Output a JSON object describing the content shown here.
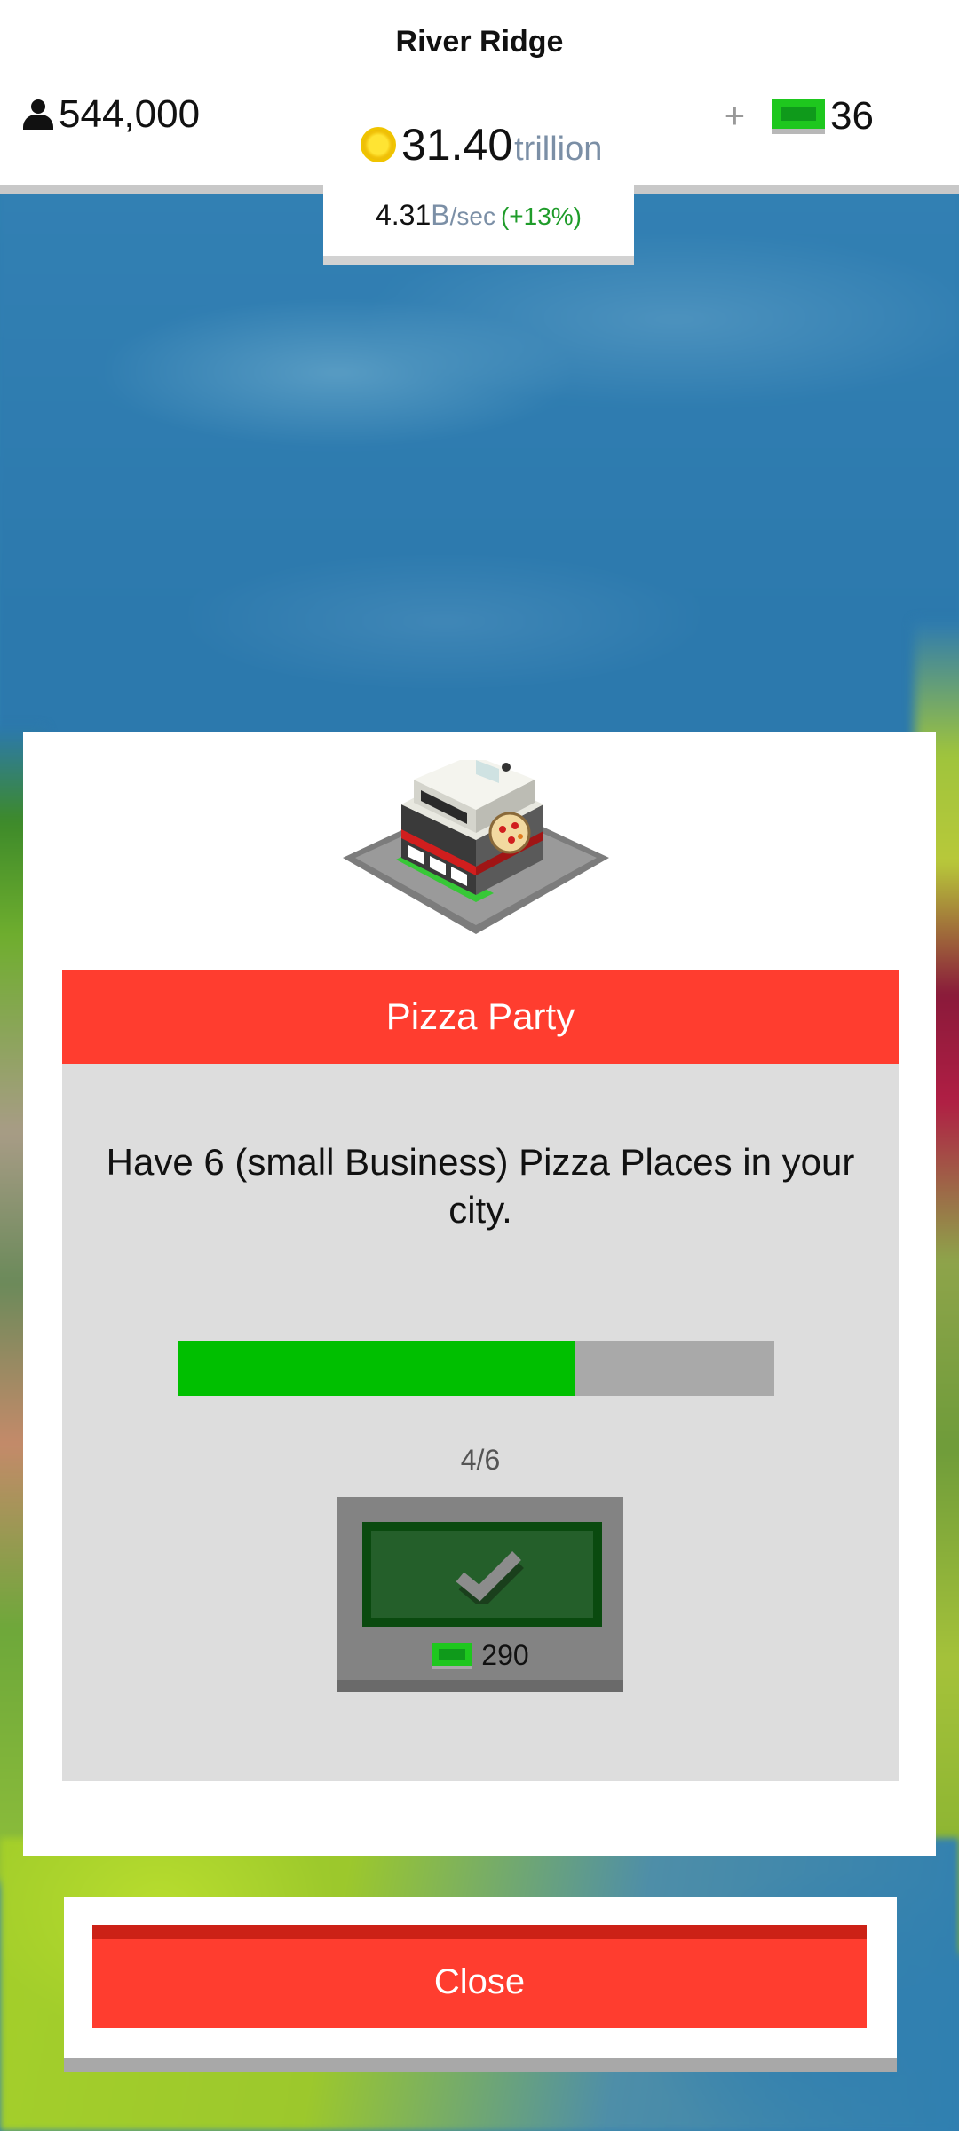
{
  "hud": {
    "city_name": "River Ridge",
    "population": "544,000",
    "coins": {
      "amount": "31.40",
      "unit": "trillion"
    },
    "income": {
      "amount": "4.31",
      "unit": "B",
      "per": "/sec",
      "change": "(+13%)"
    },
    "cash": {
      "plus": "+",
      "amount": "36"
    }
  },
  "icons": {
    "population": "person-icon",
    "coins": "coin-icon",
    "cash": "cash-icon",
    "claim": "checkmark-icon"
  },
  "colors": {
    "accent_red": "#ff3d2f",
    "progress_green": "#00bf00",
    "cash_green": "#1ec71e",
    "claim_dark_green": "#245f2a"
  },
  "dialog": {
    "title": "Pizza Party",
    "description": "Have 6 (small Business) Pizza Places in your city.",
    "progress": {
      "current": 4,
      "target": 6,
      "fraction": 0.6667,
      "label": "4/6"
    },
    "reward": {
      "amount": "290"
    }
  },
  "close_button": {
    "label": "Close"
  }
}
